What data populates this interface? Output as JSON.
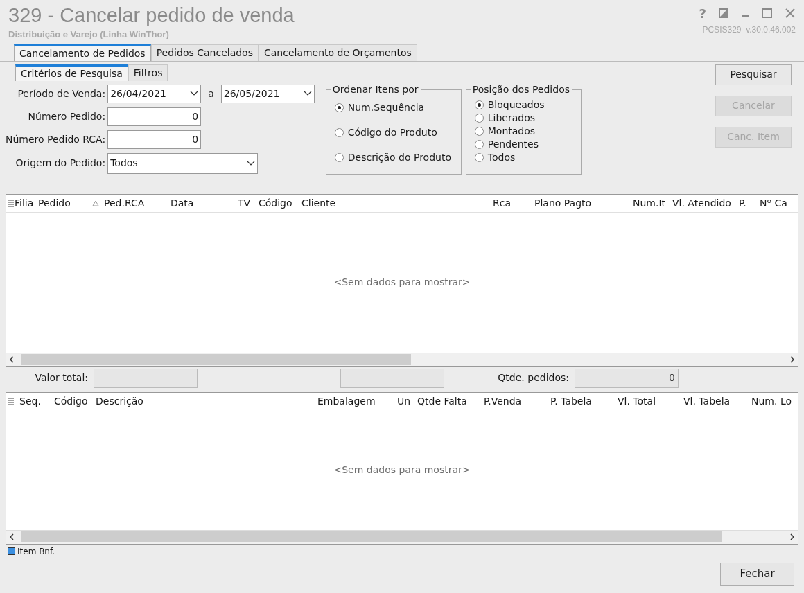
{
  "window": {
    "title": "329 - Cancelar pedido de venda",
    "subtitle": "Distribuição e Varejo (Linha WinThor)",
    "version": "PCSIS329  v.30.0.46.002",
    "help": "?"
  },
  "tabs": [
    {
      "label": "Cancelamento de Pedidos",
      "selected": true
    },
    {
      "label": "Pedidos Cancelados",
      "selected": false
    },
    {
      "label": "Cancelamento de Orçamentos",
      "selected": false
    }
  ],
  "subtabs": [
    {
      "label": "Critérios de Pesquisa",
      "selected": true
    },
    {
      "label": "Filtros",
      "selected": false
    }
  ],
  "form": {
    "periodo_label": "Período de Venda:",
    "date_from": "26/04/2021",
    "range_sep": "a",
    "date_to": "26/05/2021",
    "numero_pedido_label": "Número Pedido:",
    "numero_pedido": "0",
    "numero_rca_label": "Número Pedido RCA:",
    "numero_rca": "0",
    "origem_label": "Origem do Pedido:",
    "origem": "Todos"
  },
  "ordenar": {
    "title": "Ordenar Itens por",
    "options": [
      {
        "label": "Num.Sequência",
        "selected": true
      },
      {
        "label": "Código do Produto",
        "selected": false
      },
      {
        "label": "Descrição do Produto",
        "selected": false
      }
    ]
  },
  "posicao": {
    "title": "Posição dos Pedidos",
    "options": [
      {
        "label": "Bloqueados",
        "selected": true
      },
      {
        "label": "Liberados",
        "selected": false
      },
      {
        "label": "Montados",
        "selected": false
      },
      {
        "label": "Pendentes",
        "selected": false
      },
      {
        "label": "Todos",
        "selected": false
      }
    ]
  },
  "actions": [
    {
      "label": "Pesquisar",
      "disabled": false
    },
    {
      "label": "Cancelar",
      "disabled": true
    },
    {
      "label": "Canc. Item",
      "disabled": true
    }
  ],
  "orders_table": {
    "columns": [
      {
        "label": "Filia",
        "sorted": false
      },
      {
        "label": "Pedido",
        "sorted": true
      },
      {
        "label": "Ped.RCA",
        "sorted": false
      },
      {
        "label": "Data",
        "sorted": false
      },
      {
        "label": "TV",
        "sorted": false
      },
      {
        "label": "Código",
        "sorted": false
      },
      {
        "label": "Cliente",
        "sorted": false
      },
      {
        "label": "Rca",
        "sorted": false
      },
      {
        "label": "Plano Pagto",
        "sorted": false
      },
      {
        "label": "Num.It",
        "sorted": false
      },
      {
        "label": "Vl. Atendido",
        "sorted": false
      },
      {
        "label": "P.",
        "sorted": false
      },
      {
        "label": "Nº Ca",
        "sorted": false
      }
    ],
    "empty": "<Sem dados para mostrar>"
  },
  "totals": {
    "valor_label": "Valor total:",
    "qtde_label": "Qtde. pedidos:",
    "qtde": "0"
  },
  "items_table": {
    "columns": [
      "Seq.",
      "Código",
      "Descrição",
      "Embalagem",
      "Un",
      "Qtde Falta",
      "P.Venda",
      "P. Tabela",
      "Vl. Total",
      "Vl. Tabela",
      "Num. Lo"
    ],
    "empty": "<Sem dados para mostrar>"
  },
  "legend": [
    {
      "label": "Item Bnf.",
      "color": "#3b8fe0"
    }
  ],
  "close_button": "Fechar"
}
